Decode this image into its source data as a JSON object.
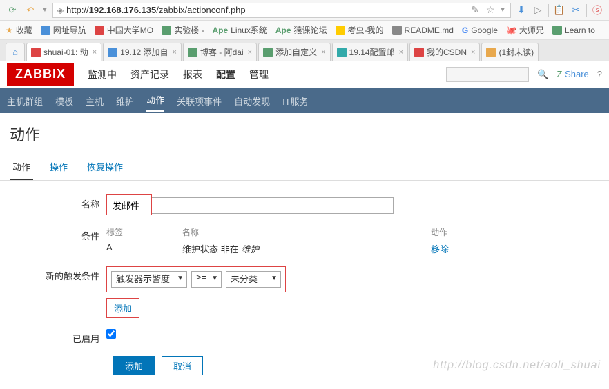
{
  "url": {
    "prefix": "http://",
    "host": "192.168.176.135",
    "path": "/zabbix/actionconf.php"
  },
  "bookmarks": [
    {
      "label": "收藏"
    },
    {
      "label": "网址导航"
    },
    {
      "label": "中国大学MO"
    },
    {
      "label": "实验楼 -"
    },
    {
      "label": "Linux系统"
    },
    {
      "label": "猿课论坛"
    },
    {
      "label": "考虫-我的"
    },
    {
      "label": "README.md"
    },
    {
      "label": "Google"
    },
    {
      "label": "大师兄"
    },
    {
      "label": "Learn to"
    }
  ],
  "browser_tabs": [
    {
      "label": "shuai-01: 动",
      "active": true
    },
    {
      "label": "19.12 添加自"
    },
    {
      "label": "博客 - 阿dai"
    },
    {
      "label": "添加自定义"
    },
    {
      "label": "19.14配置邮"
    },
    {
      "label": "我的CSDN"
    },
    {
      "label": "(1封未读)"
    }
  ],
  "zabbix": {
    "logo": "ZABBIX",
    "nav": [
      "监测中",
      "资产记录",
      "报表",
      "配置",
      "管理"
    ],
    "nav_active": 3,
    "share": "Share",
    "subnav": [
      "主机群组",
      "模板",
      "主机",
      "维护",
      "动作",
      "关联项事件",
      "自动发现",
      "IT服务"
    ],
    "subnav_active": 4
  },
  "page_title": "动作",
  "content_tabs": [
    "动作",
    "操作",
    "恢复操作"
  ],
  "content_tab_active": 0,
  "form": {
    "name_label": "名称",
    "name_value": "发邮件",
    "cond_label": "条件",
    "cond_head": {
      "tag": "标签",
      "name": "名称",
      "action": "动作"
    },
    "cond_row": {
      "tag": "A",
      "name_prefix": "维护状态 非在 ",
      "name_italic": "维护",
      "remove": "移除"
    },
    "newcond_label": "新的触发条件",
    "sel1": "触发器示警度",
    "sel2": ">=",
    "sel3": "未分类",
    "add_link": "添加",
    "enabled_label": "已启用",
    "btn_add": "添加",
    "btn_cancel": "取消"
  },
  "watermark": "http://blog.csdn.net/aoli_shuai"
}
